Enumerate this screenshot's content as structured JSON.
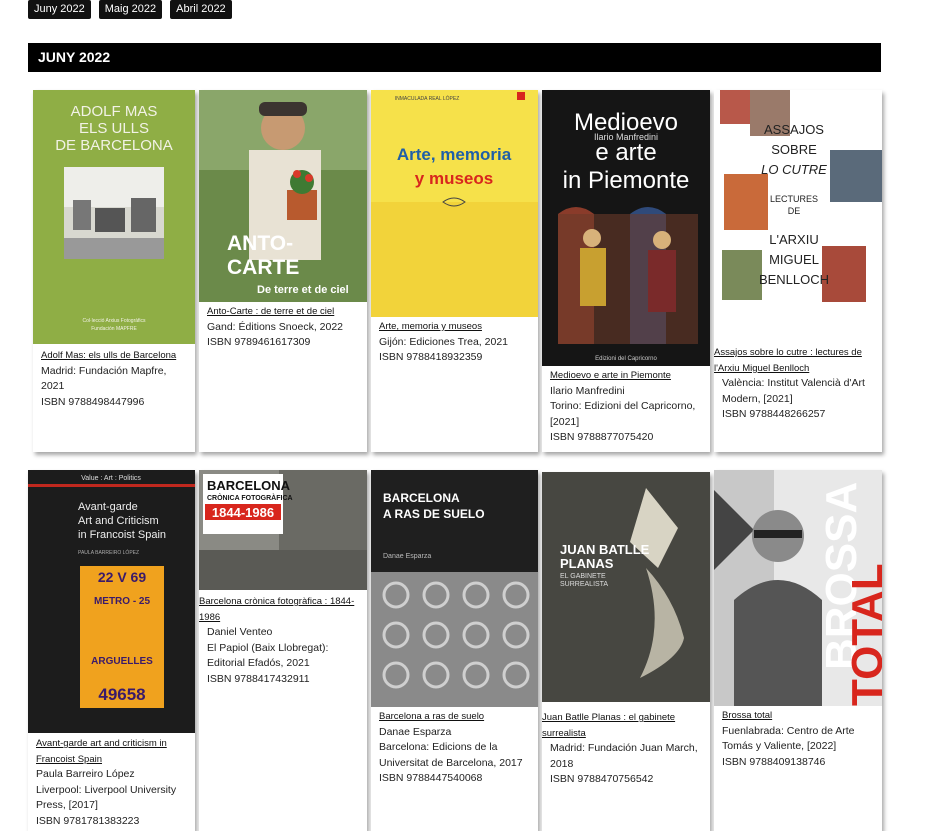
{
  "tabs": [
    "Juny 2022",
    "Maig 2022",
    "Abril 2022"
  ],
  "section_title": "JUNY 2022",
  "books": [
    {
      "title": "Adolf Mas: els ulls de Barcelona",
      "pub": "Madrid: Fundación Mapfre, 2021",
      "isbn": "ISBN 9788498447996",
      "cover": {
        "l1": "ADOLF MAS",
        "l2": "ELS ULLS",
        "l3": "DE BARCELONA",
        "foot1": "Col·lecció Arxius Fotogràfics",
        "foot2": "Fundación MAPFRE"
      }
    },
    {
      "title": "Anto-Carte : de terre et de ciel",
      "pub": "Gand: Éditions Snoeck, 2022",
      "isbn": "ISBN 9789461617309",
      "cover": {
        "l1": "ANTO-",
        "l2": "CARTE",
        "l3": "De terre et de ciel"
      }
    },
    {
      "title": "Arte, memoria y museos",
      "pub": "Gijón: Ediciones Trea, 2021",
      "isbn": "ISBN 9788418932359",
      "cover": {
        "author": "INMACULADA REAL LÓPEZ",
        "l1": "Arte, memoria",
        "l2": "y museos"
      }
    },
    {
      "title": "Medioevo e arte in Piemonte",
      "author": "Ilario Manfredini",
      "pub": "Torino: Edizioni del Capricorno, [2021]",
      "isbn": "ISBN 9788877075420",
      "cover": {
        "author": "Ilario Manfredini",
        "l1": "Medioevo",
        "l2": "e arte",
        "l3": "in Piemonte",
        "pub": "Edizioni del Capricorno"
      }
    },
    {
      "title": "Assajos sobre lo cutre : lectures de l'Arxiu Miguel Benlloch",
      "pub": "València: Institut Valencià d'Art Modern, [2021]",
      "isbn": "ISBN 9788448266257",
      "cover": {
        "l1": "ASSAJOS",
        "l2": "SOBRE",
        "l3": "LO CUTRE",
        "l4": "LECTURES",
        "l5": "DE",
        "l6": "L'ARXIU",
        "l7": "MIGUEL",
        "l8": "BENLLOCH"
      }
    },
    {
      "title": "Avant-garde art and criticism in Francoist Spain",
      "author": "Paula Barreiro López",
      "pub": "Liverpool: Liverpool University Press, [2017]",
      "isbn": "ISBN 9781781383223",
      "cover": {
        "top": "Value : Art : Politics",
        "l1": "Avant-garde",
        "l2": "Art and Criticism",
        "l3": "in Francoist Spain",
        "author": "PAULA BARREIRO LÓPEZ",
        "t1": "22 V 69",
        "t2": "METRO - 25",
        "t3": "ARGUELLES",
        "t4": "49658"
      }
    },
    {
      "title": "Barcelona crònica fotogràfica : 1844-1986",
      "author": "Daniel Venteo",
      "pub": "El Papiol (Baix Llobregat): Editorial Efadós, 2021",
      "isbn": "ISBN 9788417432911",
      "cover": {
        "l1": "BARCELONA",
        "l2": "CRÒNICA FOTOGRÀFICA",
        "l3": "1844-1986"
      }
    },
    {
      "title": "Barcelona a ras de suelo",
      "author": "Danae Esparza",
      "pub": "Barcelona: Edicions de la Universitat de Barcelona, 2017",
      "isbn": "ISBN 9788447540068",
      "cover": {
        "l1": "BARCELONA",
        "l2": "A RAS DE SUELO",
        "author": "Danae Esparza"
      }
    },
    {
      "title": "Juan Batlle Planas : el gabinete surrealista",
      "pub": "Madrid: Fundación Juan March, 2018",
      "isbn": "ISBN 9788470756542",
      "cover": {
        "l1": "JUAN BATLLE",
        "l2": "PLANAS",
        "l3": "EL GABINETE",
        "l4": "SURREALISTA"
      }
    },
    {
      "title": "Brossa total",
      "pub": "Fuenlabrada: Centro de Arte Tomás y Valiente, [2022]",
      "isbn": "ISBN 9788409138746",
      "cover": {
        "l1": "BROSSA",
        "l2": "TOTAL"
      }
    }
  ]
}
